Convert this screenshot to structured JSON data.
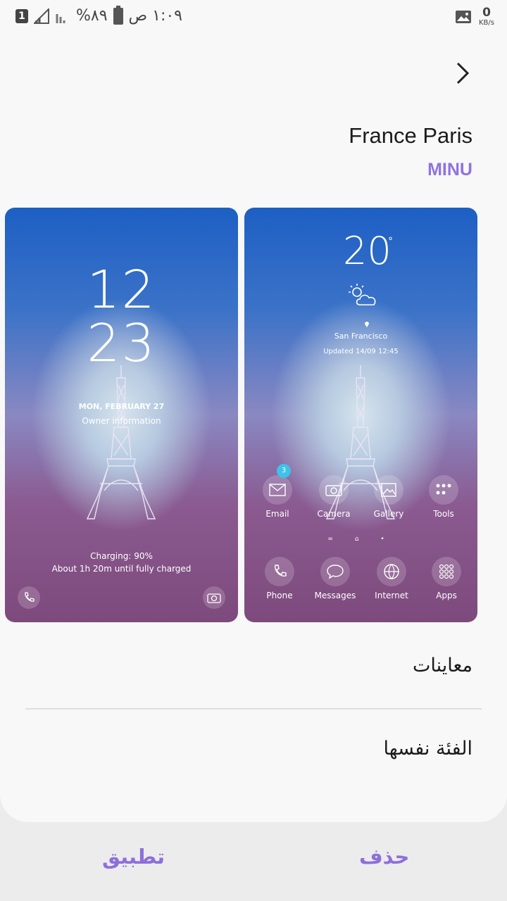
{
  "status_bar": {
    "time": "١:٠٩ ص",
    "battery": "%٨٩",
    "sim_label": "1",
    "network_speed_value": "0",
    "network_speed_unit": "KB/s"
  },
  "theme": {
    "title": "France Paris",
    "author": "MINU"
  },
  "lock_preview": {
    "hour": "12",
    "minute": "23",
    "date": "MON, FEBRUARY 27",
    "owner": "Owner information",
    "charging": "Charging: 90%",
    "charging_time": "About 1h 20m until fully charged"
  },
  "home_preview": {
    "temperature": "20",
    "degree": "°",
    "city": "San Francisco",
    "updated": "Updated 14/09 12:45",
    "email_badge": "3",
    "apps_row1": [
      "Email",
      "Camera",
      "Gallery",
      "Tools"
    ],
    "apps_row2": [
      "Phone",
      "Messages",
      "Internet",
      "Apps"
    ]
  },
  "sections": {
    "previews": "معاينات",
    "same_category": "الفئة نفسها"
  },
  "actions": {
    "apply": "تطبيق",
    "delete": "حذف"
  },
  "colors": {
    "accent": "#8d6fdc",
    "badge": "#3fc2e8"
  }
}
